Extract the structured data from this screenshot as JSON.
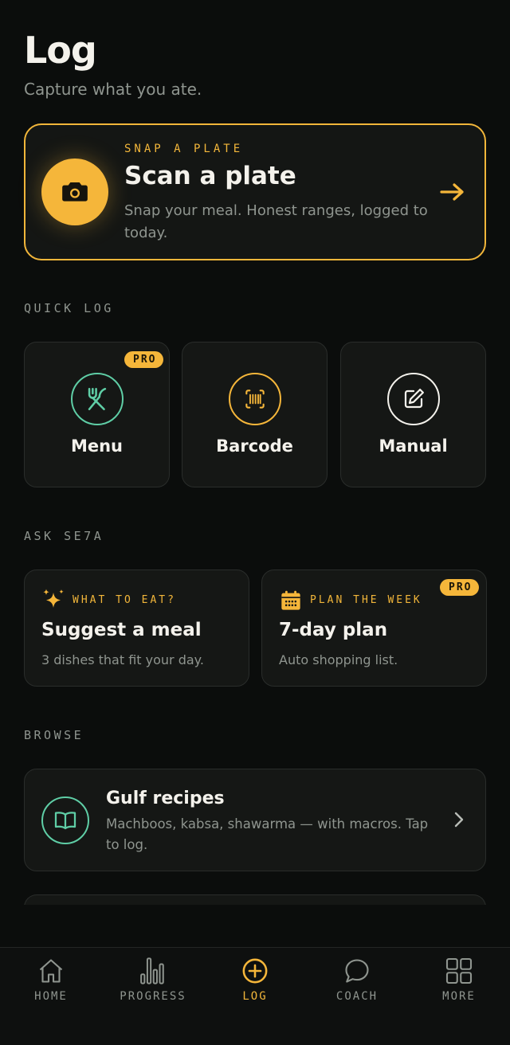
{
  "page": {
    "title": "Log",
    "subtitle": "Capture what you ate."
  },
  "scan": {
    "eyebrow": "SNAP A PLATE",
    "title": "Scan a plate",
    "description": "Snap your meal. Honest ranges, logged to today.",
    "icon": "camera-icon",
    "accent": "#f5b63a"
  },
  "quick_log": {
    "label": "QUICK LOG",
    "tiles": [
      {
        "label": "Menu",
        "icon": "fork-knife-icon",
        "badge": "PRO",
        "color": "#5fcea6"
      },
      {
        "label": "Barcode",
        "icon": "barcode-icon",
        "color": "#f5b63a"
      },
      {
        "label": "Manual",
        "icon": "edit-icon",
        "color": "#f4f2ec"
      }
    ]
  },
  "ask": {
    "label": "ASK SE7A",
    "cards": [
      {
        "eyebrow": "WHAT TO EAT?",
        "title": "Suggest a meal",
        "description": "3 dishes that fit your day.",
        "icon": "sparkles-icon"
      },
      {
        "eyebrow": "PLAN THE WEEK",
        "title": "7-day plan",
        "description": "Auto shopping list.",
        "icon": "calendar-icon",
        "badge": "PRO"
      }
    ]
  },
  "browse": {
    "label": "BROWSE",
    "items": [
      {
        "title": "Gulf recipes",
        "description": "Machboos, kabsa, shawarma — with macros. Tap to log.",
        "icon": "book-icon"
      }
    ]
  },
  "nav": {
    "items": [
      {
        "label": "HOME",
        "icon": "home-icon"
      },
      {
        "label": "PROGRESS",
        "icon": "bar-chart-icon"
      },
      {
        "label": "LOG",
        "icon": "plus-circle-icon",
        "active": true
      },
      {
        "label": "COACH",
        "icon": "chat-bubble-icon"
      },
      {
        "label": "MORE",
        "icon": "grid-icon"
      }
    ]
  }
}
